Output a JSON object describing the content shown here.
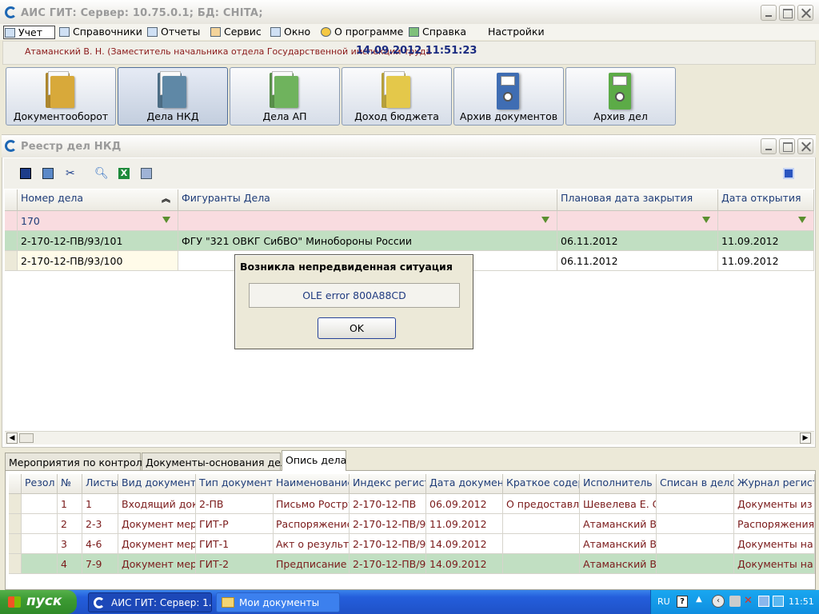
{
  "app": {
    "title": "АИС ГИТ:  Сервер: 10.75.0.1;  БД: CHITA;",
    "menu": [
      "Учет",
      "Справочники",
      "Отчеты",
      "Сервис",
      "Окно",
      "О программе",
      "Справка",
      "Настройки"
    ],
    "user": "Атаманский В. Н. (Заместитель начальника отдела Государственной инспекции труда",
    "datetime": "14.09.2012  11:51:23"
  },
  "modules": [
    {
      "label": "Документооборот",
      "icon": "folder-icon",
      "color": "#d8a93a"
    },
    {
      "label": "Дела НКД",
      "icon": "folder-icon",
      "color": "#5f88a6"
    },
    {
      "label": "Дела АП",
      "icon": "folder-icon",
      "color": "#6fb35d"
    },
    {
      "label": "Доход бюджета",
      "icon": "folder-icon",
      "color": "#e4c84a"
    },
    {
      "label": "Архив документов",
      "icon": "binder-icon",
      "color": "#3f6db3"
    },
    {
      "label": "Архив дел",
      "icon": "binder-icon",
      "color": "#5cab47"
    }
  ],
  "registry": {
    "title": "Реестр дел НКД",
    "columns": [
      "Номер дела",
      "Фигуранты Дела",
      "Плановая дата закрытия",
      "Дата открытия"
    ],
    "filter": "170",
    "rows": [
      [
        "2-170-12-ПВ/93/101",
        "ФГУ \"321 ОВКГ СибВО\" Минобороны России",
        "06.11.2012",
        "11.09.2012"
      ],
      [
        "2-170-12-ПВ/93/100",
        "",
        "06.11.2012",
        "11.09.2012"
      ]
    ]
  },
  "dialog": {
    "title": "Возникла непредвиденная ситуация",
    "message": "OLE error 800A88CD",
    "ok": "OK"
  },
  "tabs": [
    "Мероприятия по контролю",
    "Документы-основания дела",
    "Опись дела"
  ],
  "inventory": {
    "columns": [
      "Резол",
      "№",
      "Листы",
      "Вид документа",
      "Тип документа",
      "Наименование ,",
      "Индекс регистр",
      "Дата документа",
      "Краткое содерж",
      "Исполнитель",
      "Списан в дело",
      "Журнал регистр"
    ],
    "rows": [
      [
        "",
        "1",
        "1",
        "Входящий док",
        "2-ПВ",
        "Письмо Рострух",
        "2-170-12-ПВ",
        "06.09.2012",
        "О предоставл",
        "Шевелева Е. С",
        "",
        "Документы из"
      ],
      [
        "",
        "2",
        "2-3",
        "Документ мер",
        "ГИТ-Р",
        "Распоряжение",
        "2-170-12-ПВ/9",
        "11.09.2012",
        "",
        "Атаманский В.",
        "",
        "Распоряжения"
      ],
      [
        "",
        "3",
        "4-6",
        "Документ мер",
        "ГИТ-1",
        "Акт о результ",
        "2-170-12-ПВ/9",
        "14.09.2012",
        "",
        "Атаманский В.",
        "",
        "Документы на"
      ],
      [
        "",
        "4",
        "7-9",
        "Документ мер",
        "ГИТ-2",
        "Предписание",
        "2-170-12-ПВ/9",
        "14.09.2012",
        "",
        "Атаманский В.",
        "",
        "Документы на"
      ]
    ]
  },
  "taskbar": {
    "start": "пуск",
    "tasks": [
      "АИС ГИТ:  Сервер: 1...",
      "Мои документы"
    ],
    "lang": "RU",
    "clock": "11:51"
  }
}
